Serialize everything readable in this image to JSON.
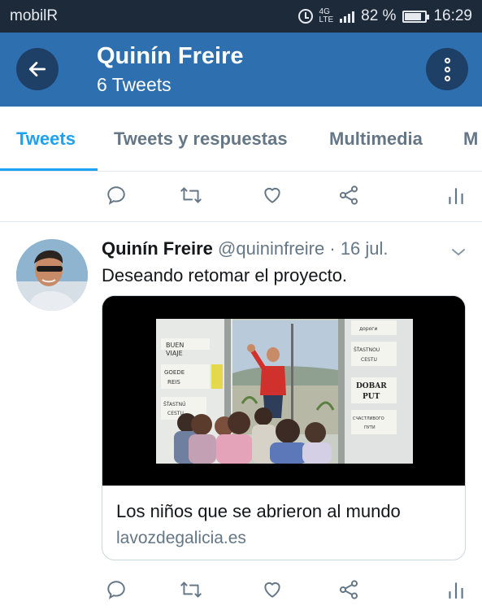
{
  "status_bar": {
    "carrier": "mobilR",
    "network": "4G LTE",
    "battery": "82 %",
    "time": "16:29"
  },
  "header": {
    "title": "Quinín Freire",
    "subtitle": "6 Tweets",
    "back_icon": "arrow-left-icon",
    "menu_icon": "more-vertical-icon",
    "background": "#2e6fb0"
  },
  "tabs": [
    {
      "label": "Tweets",
      "active": true
    },
    {
      "label": "Tweets y respuestas",
      "active": false
    },
    {
      "label": "Multimedia",
      "active": false
    },
    {
      "label": "M",
      "active": false
    }
  ],
  "tweet": {
    "author_name": "Quinín Freire",
    "handle": "@quininfreire",
    "separator": "·",
    "date": "16 jul.",
    "text": "Deseando retomar el proyecto.",
    "card": {
      "title": "Los niños que se abrieron al mundo",
      "domain": "lavozdegalicia.es",
      "image_sign_left": [
        "BUEN",
        "VIAJE",
        "GOEDE",
        "REIS",
        "ŠŤASTNÚ",
        "CESTU"
      ],
      "image_sign_right": [
        "дороги",
        "ŠŤASTNOU",
        "CESTU",
        "DOBAR",
        "PUT",
        "СЧАСТЛИВОГО",
        "ПУТИ"
      ]
    }
  },
  "action_icons": [
    "reply-icon",
    "retweet-icon",
    "like-icon",
    "share-icon",
    "analytics-icon"
  ],
  "colors": {
    "accent": "#1da1f2",
    "header": "#2e6fb0",
    "header_buttons": "#1e3f66",
    "muted_text": "#657786"
  }
}
